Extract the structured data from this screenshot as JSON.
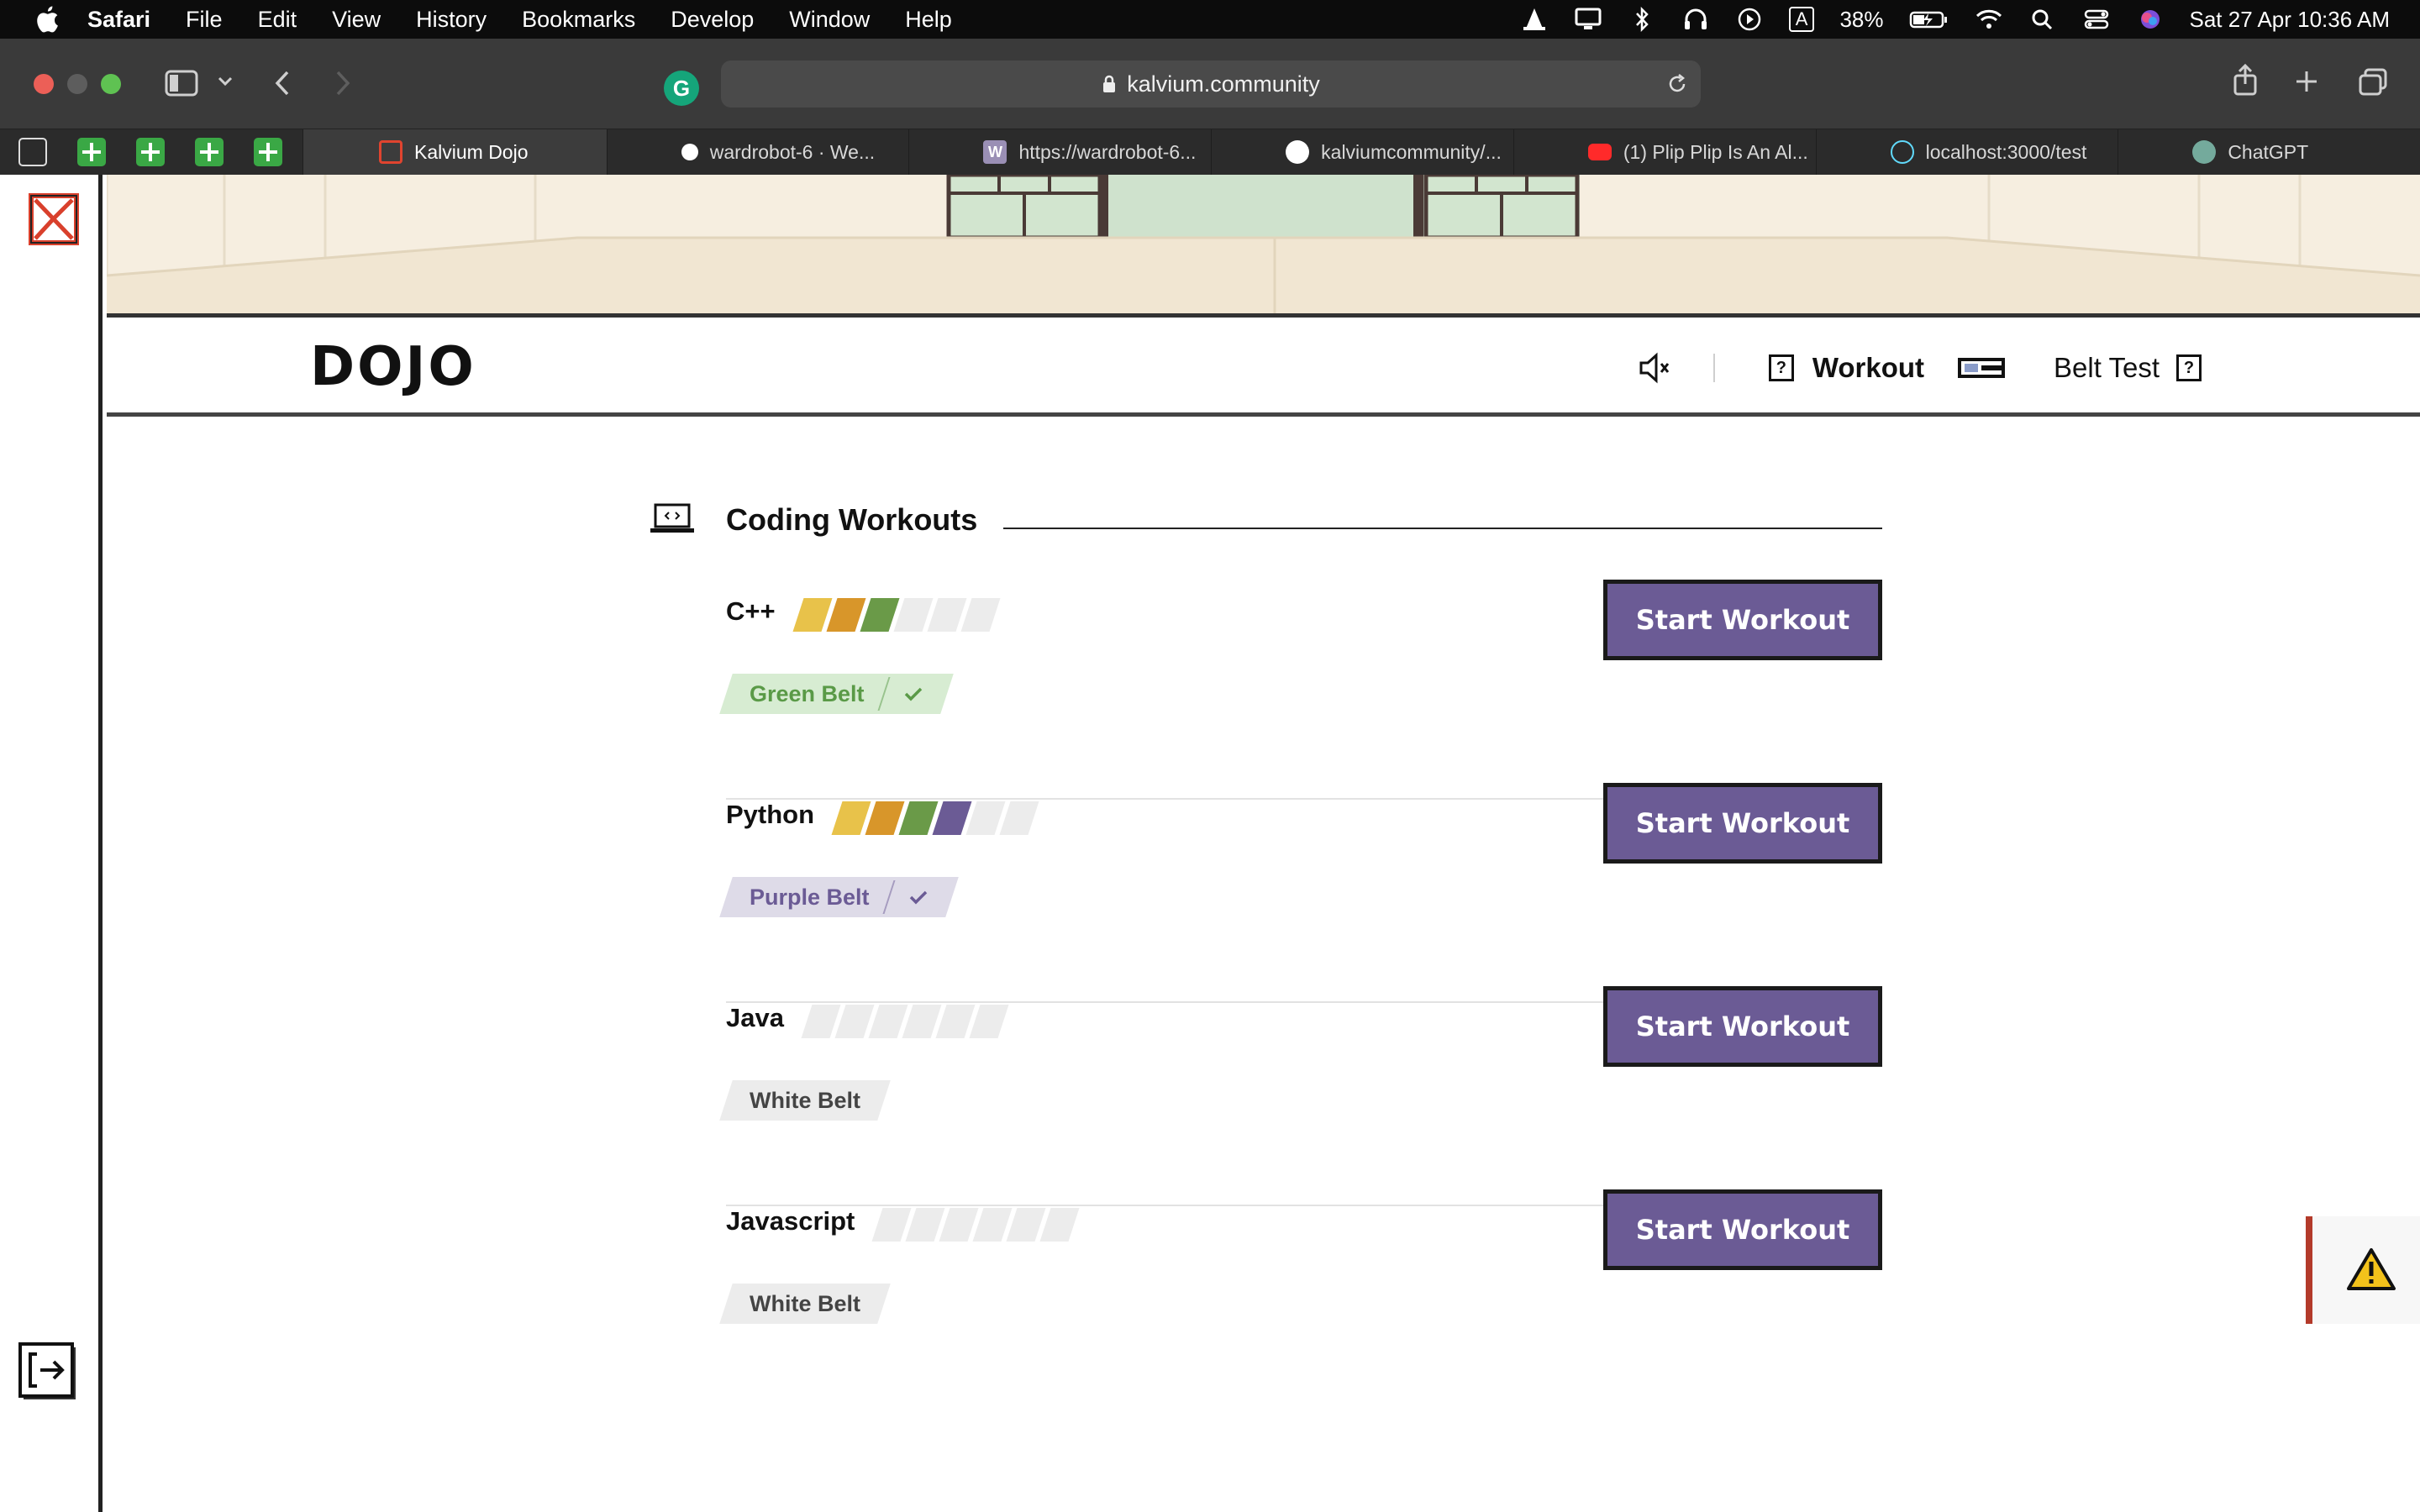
{
  "menubar": {
    "app_name": "Safari",
    "items": [
      "File",
      "Edit",
      "View",
      "History",
      "Bookmarks",
      "Develop",
      "Window",
      "Help"
    ],
    "battery": "38%",
    "datetime": "Sat 27 Apr  10:36 AM",
    "input_badge": "A"
  },
  "browser": {
    "url": "kalvium.community",
    "tabs": [
      {
        "title": "Kalvium Dojo",
        "active": true,
        "fav_color": "#e0442f"
      },
      {
        "title": "wardrobot-6  ·  We...",
        "active": false,
        "fav_color": "#ffffff"
      },
      {
        "title": "https://wardrobot-6...",
        "active": false,
        "fav_color": "#9a8fb5"
      },
      {
        "title": "kalviumcommunity/...",
        "active": false,
        "fav_color": "#ffffff"
      },
      {
        "title": "(1) Plip Plip Is An Al...",
        "active": false,
        "fav_color": "#ff2a2a"
      },
      {
        "title": "localhost:3000/test",
        "active": false,
        "fav_color": "#61dafb"
      },
      {
        "title": "ChatGPT",
        "active": false,
        "fav_color": "#74aa9c"
      }
    ]
  },
  "header": {
    "title": "DOJO",
    "workout_label": "Workout",
    "belt_test_label": "Belt Test",
    "help_glyph": "?"
  },
  "section": {
    "title": "Coding Workouts"
  },
  "workouts": [
    {
      "language": "C++",
      "progress_levels": 3,
      "bar_colors": [
        "#e8c24a",
        "#d8962a",
        "#6a9a48",
        "#ececec",
        "#ececec",
        "#ececec"
      ],
      "belt": "Green Belt",
      "completed": true,
      "belt_bg": "#d7ecd2",
      "belt_fg": "#5a9a47",
      "button": "Start Workout"
    },
    {
      "language": "Python",
      "progress_levels": 4,
      "bar_colors": [
        "#e8c24a",
        "#d8962a",
        "#6a9a48",
        "#6b5b95",
        "#ececec",
        "#ececec"
      ],
      "belt": "Purple Belt",
      "completed": true,
      "belt_bg": "#dedbe8",
      "belt_fg": "#6b5b95",
      "button": "Start Workout"
    },
    {
      "language": "Java",
      "progress_levels": 0,
      "bar_colors": [
        "#ececec",
        "#ececec",
        "#ececec",
        "#ececec",
        "#ececec",
        "#ececec"
      ],
      "belt": "White Belt",
      "completed": false,
      "belt_bg": "#ececec",
      "belt_fg": "#444444",
      "button": "Start Workout"
    },
    {
      "language": "Javascript",
      "progress_levels": 0,
      "bar_colors": [
        "#ececec",
        "#ececec",
        "#ececec",
        "#ececec",
        "#ececec",
        "#ececec"
      ],
      "belt": "White Belt",
      "completed": false,
      "belt_bg": "#ececec",
      "belt_fg": "#444444",
      "button": "Start Workout"
    }
  ],
  "colors": {
    "accent": "#6b5b95",
    "warning": "#b33a2a"
  },
  "icons": [
    "apple-icon",
    "sound-muted-icon",
    "help-icon",
    "belt-icon",
    "laptop-code-icon",
    "check-icon",
    "warning-icon",
    "logout-icon",
    "kalvium-logo-icon"
  ]
}
